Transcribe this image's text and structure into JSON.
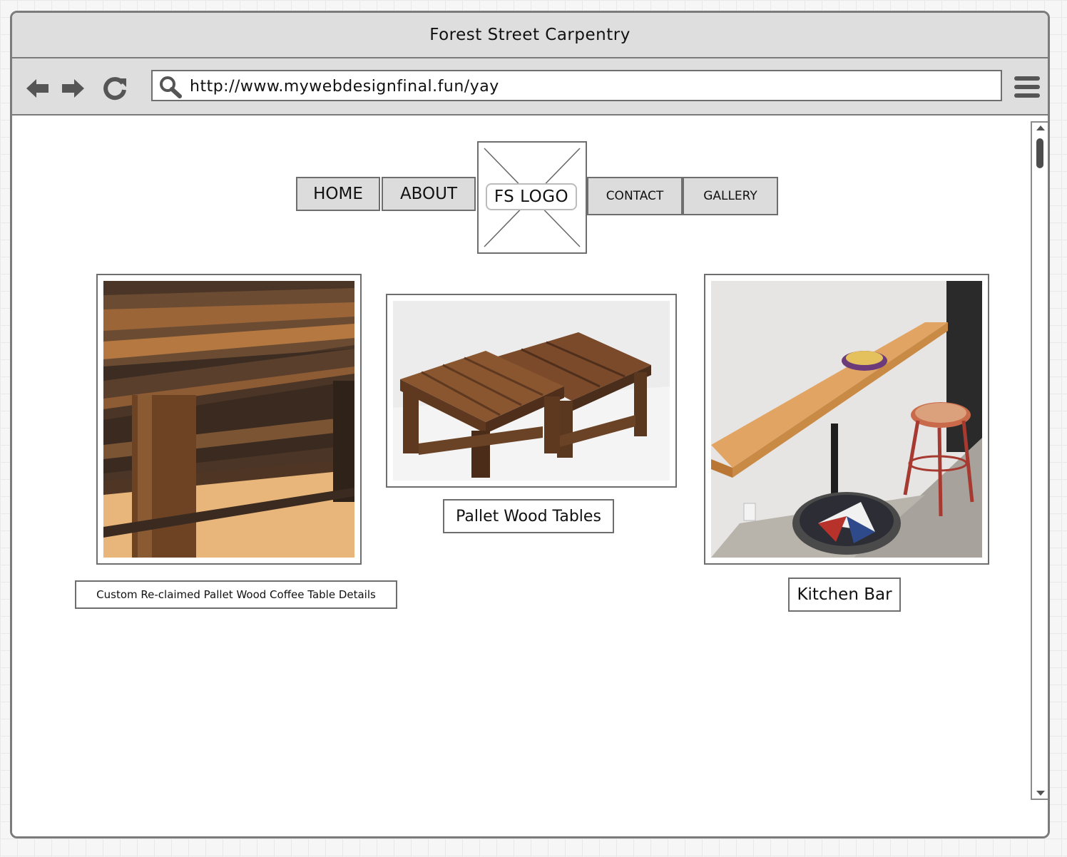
{
  "window": {
    "title": "Forest Street Carpentry"
  },
  "toolbar": {
    "url": "http://www.mywebdesignfinal.fun/yay",
    "back_icon": "arrow-left-icon",
    "forward_icon": "arrow-right-icon",
    "reload_icon": "reload-icon",
    "search_icon": "search-icon",
    "menu_icon": "hamburger-menu-icon"
  },
  "nav": {
    "home": "HOME",
    "about": "ABOUT",
    "logo": "FS LOGO",
    "contact": "CONTACT",
    "gallery": "GALLERY"
  },
  "gallery": {
    "items": [
      {
        "caption": "Custom Re-claimed Pallet Wood Coffee Table Details"
      },
      {
        "caption": "Pallet Wood Tables"
      },
      {
        "caption": "Kitchen Bar"
      }
    ]
  },
  "colors": {
    "chrome": "#dedede",
    "border": "#7b7b7b",
    "button": "#dcdcdc",
    "wood_dark": "#5a3b22",
    "wood_light": "#d9a25e"
  }
}
